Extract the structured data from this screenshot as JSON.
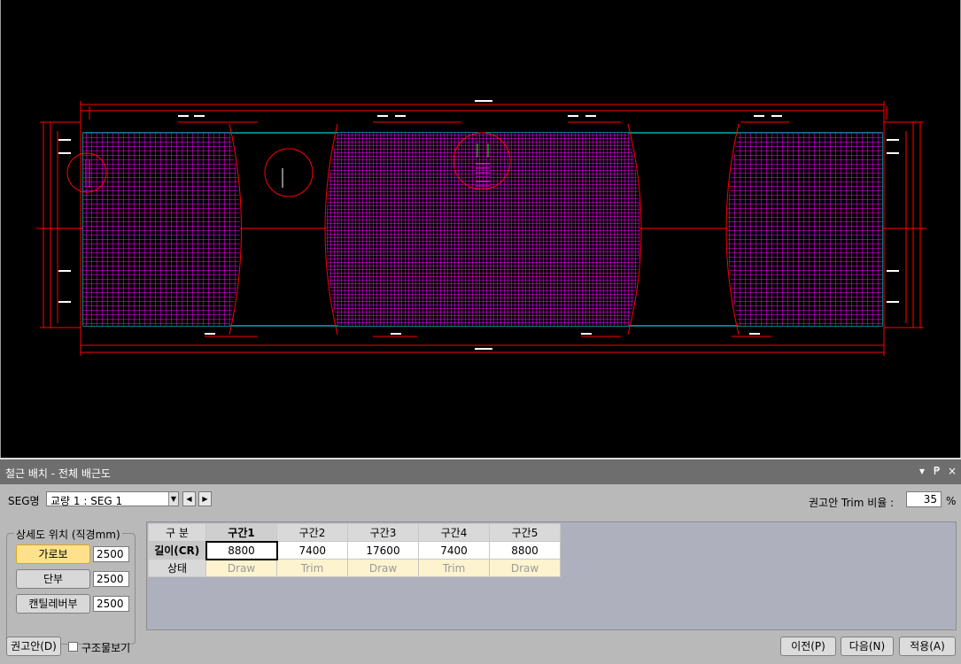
{
  "panel": {
    "title": "철근 배치 - 전체 배근도",
    "controls": {
      "menu": "▾",
      "pin": "₱",
      "close": "×"
    }
  },
  "seg": {
    "label": "SEG명",
    "selected": "교량 1 : SEG 1",
    "prev": "◀",
    "next": "▶"
  },
  "trim": {
    "label": "권고안 Trim 비율 :",
    "value": "35",
    "unit": "%"
  },
  "detail_position": {
    "title": "상세도 위치 (직경mm)",
    "items": [
      {
        "label": "가로보",
        "value": "2500",
        "active": true
      },
      {
        "label": "단부",
        "value": "2500",
        "active": false
      },
      {
        "label": "캔틸레버부",
        "value": "2500",
        "active": false
      }
    ]
  },
  "grid": {
    "corner": "구 분",
    "columns": [
      "구간1",
      "구간2",
      "구간3",
      "구간4",
      "구간5"
    ],
    "rows": [
      {
        "header": "길이(CR)",
        "cells": [
          "8800",
          "7400",
          "17600",
          "7400",
          "8800"
        ]
      },
      {
        "header": "상태",
        "cells": [
          "Draw",
          "Trim",
          "Draw",
          "Trim",
          "Draw"
        ]
      }
    ]
  },
  "footer": {
    "recommend_button": "권고안(D)",
    "structure_view_label": "구조물보기",
    "structure_view_checked": false,
    "prev_button": "이전(P)",
    "next_button": "다음(N)",
    "apply_button": "적용(A)"
  },
  "colors": {
    "background": "#000000",
    "rebar": "#ff00ff",
    "dimension": "#ff0000",
    "outline": "#00ffff",
    "panel": "#b9b9b9",
    "titlebar": "#6e6e6e",
    "active_button": "#fde28b",
    "status_cell": "#fdf3cf"
  }
}
